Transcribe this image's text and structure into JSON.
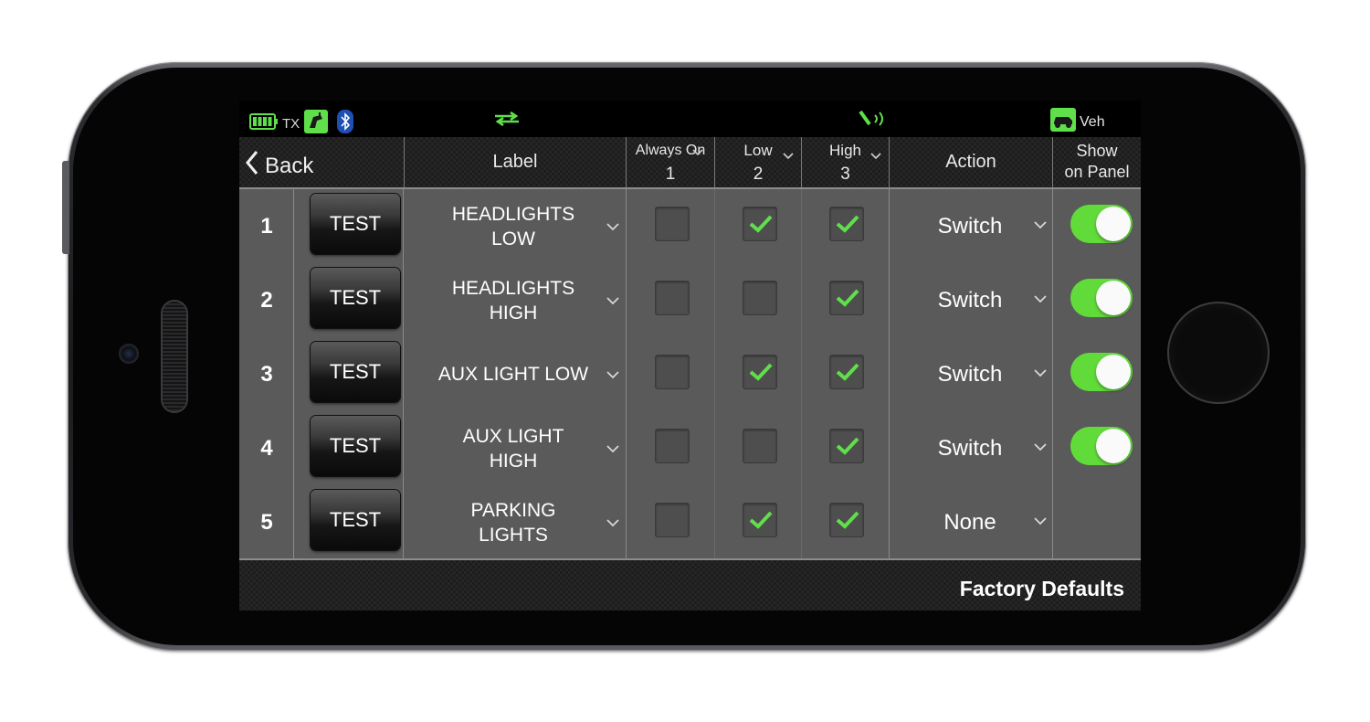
{
  "status_bar": {
    "tx_label": "TX",
    "veh_label": "Veh",
    "icons": [
      "battery-icon",
      "transmitter-icon",
      "bluetooth-icon",
      "sync-arrows-icon",
      "signal-icon",
      "vehicle-icon"
    ]
  },
  "header": {
    "back_label": "Back",
    "label_col": "Label",
    "always_on_title": "Always On",
    "always_on_num": "1",
    "low_title": "Low",
    "low_num": "2",
    "high_title": "High",
    "high_num": "3",
    "action_col": "Action",
    "show_line1": "Show",
    "show_line2": "on Panel"
  },
  "rows": [
    {
      "num": "1",
      "test": "TEST",
      "label": "HEADLIGHTS\nLOW",
      "always_on": false,
      "low": true,
      "high": true,
      "action": "Switch",
      "show": true
    },
    {
      "num": "2",
      "test": "TEST",
      "label": "HEADLIGHTS\nHIGH",
      "always_on": false,
      "low": false,
      "high": true,
      "action": "Switch",
      "show": true
    },
    {
      "num": "3",
      "test": "TEST",
      "label": "AUX LIGHT LOW",
      "always_on": false,
      "low": true,
      "high": true,
      "action": "Switch",
      "show": true
    },
    {
      "num": "4",
      "test": "TEST",
      "label": "AUX LIGHT\nHIGH",
      "always_on": false,
      "low": false,
      "high": true,
      "action": "Switch",
      "show": true
    },
    {
      "num": "5",
      "test": "TEST",
      "label": "PARKING\nLIGHTS",
      "always_on": false,
      "low": true,
      "high": true,
      "action": "None",
      "show": null
    }
  ],
  "footer": {
    "factory_defaults_label": "Factory Defaults"
  },
  "colors": {
    "accent_green": "#61db3a",
    "check_green": "#5fe04a",
    "row_bg": "#5a5a5a"
  }
}
